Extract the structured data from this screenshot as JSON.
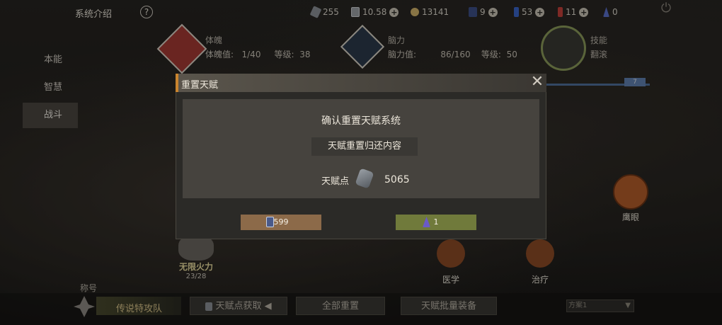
{
  "topbar": {
    "title": "系统介绍",
    "help_glyph": "?",
    "plus_glyph": "+",
    "power_glyph": "⏻",
    "resources": [
      {
        "icon": "gear-token-icon",
        "value": "255"
      },
      {
        "icon": "card-icon",
        "value": "10.58"
      },
      {
        "icon": "coin-icon",
        "value": "13141"
      },
      {
        "icon": "blue-card-icon",
        "value": "9"
      },
      {
        "icon": "blue-vial-icon",
        "value": "53"
      },
      {
        "icon": "red-vial-icon",
        "value": "11"
      },
      {
        "icon": "crystal-icon",
        "value": "0"
      }
    ]
  },
  "nav": [
    "本能",
    "智慧",
    "战斗"
  ],
  "stats": {
    "physique": {
      "title": "体魄",
      "value_label": "体魄值:",
      "value": "1/40",
      "level_label": "等级:",
      "level": "38"
    },
    "brain": {
      "title": "脑力",
      "value_label": "脑力值:",
      "value": "86/160",
      "level_label": "等级:",
      "level": "50"
    },
    "skill": {
      "title": "技能",
      "sub": "翻滚"
    }
  },
  "tiers": {
    "marker": "7"
  },
  "skills": {
    "hawkeye": "鹰眼",
    "unlimited_fire": "无限火力",
    "unlimited_fire_progress": "23/28",
    "medicine": "医学",
    "healing": "治疗"
  },
  "bottom": {
    "title_label": "称号",
    "title_value": "传说特攻队",
    "acquire": "天赋点获取",
    "caret": "◀",
    "reset_all": "全部重置",
    "batch_equip": "天赋批量装备",
    "plan": "方案1",
    "dropdown_caret": "▼"
  },
  "dialog": {
    "title": "重置天赋",
    "close_glyph": "✕",
    "heading": "确认重置天赋系统",
    "subheading": "天赋重置归还内容",
    "points_label": "天赋点",
    "points_value": "5065",
    "cost_a": "599",
    "cost_b": "1"
  },
  "colors": {
    "accent_orange": "#c9842e",
    "cost_a_bg": "#8c6a49",
    "cost_b_bg": "#707a3b",
    "nav_active_bg": "#4a4640"
  }
}
